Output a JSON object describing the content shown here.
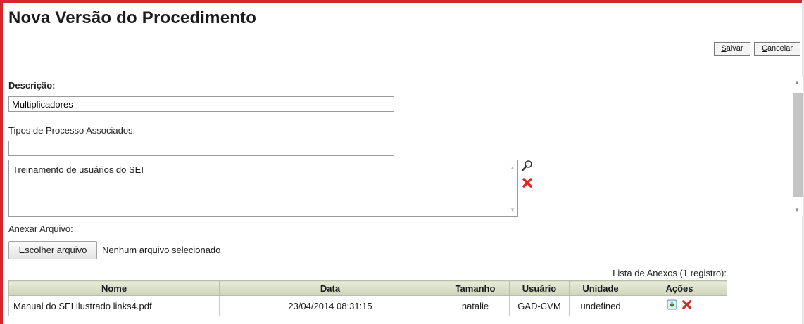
{
  "page": {
    "title": "Nova Versão do Procedimento"
  },
  "toolbar": {
    "save_label": "Salvar",
    "cancel_label": "Cancelar"
  },
  "form": {
    "description_label": "Descrição:",
    "description_value": "Multiplicadores",
    "process_types_label": "Tipos de Processo Associados:",
    "process_types_input_value": "",
    "process_types_selected": [
      "Treinamento de usuários do SEI"
    ],
    "attach_label": "Anexar Arquivo:",
    "choose_file_label": "Escolher arquivo",
    "no_file_text": "Nenhum arquivo selecionado"
  },
  "attachments": {
    "caption": "Lista de Anexos (1 registro):",
    "columns": [
      "Nome",
      "Data",
      "Tamanho",
      "Usuário",
      "Unidade",
      "Ações"
    ],
    "rows": [
      {
        "nome": "Manual do SEI ilustrado links4.pdf",
        "data": "23/04/2014 08:31:15",
        "tamanho": "natalie",
        "usuario": "GAD-CVM",
        "unidade": "undefined"
      }
    ]
  },
  "icons": {
    "search": "magnifier-icon",
    "remove": "red-x-icon",
    "download": "download-icon"
  },
  "colors": {
    "frame_red": "#d9272e",
    "header_green": "#d6dcc4",
    "remove_red": "#e02424"
  }
}
